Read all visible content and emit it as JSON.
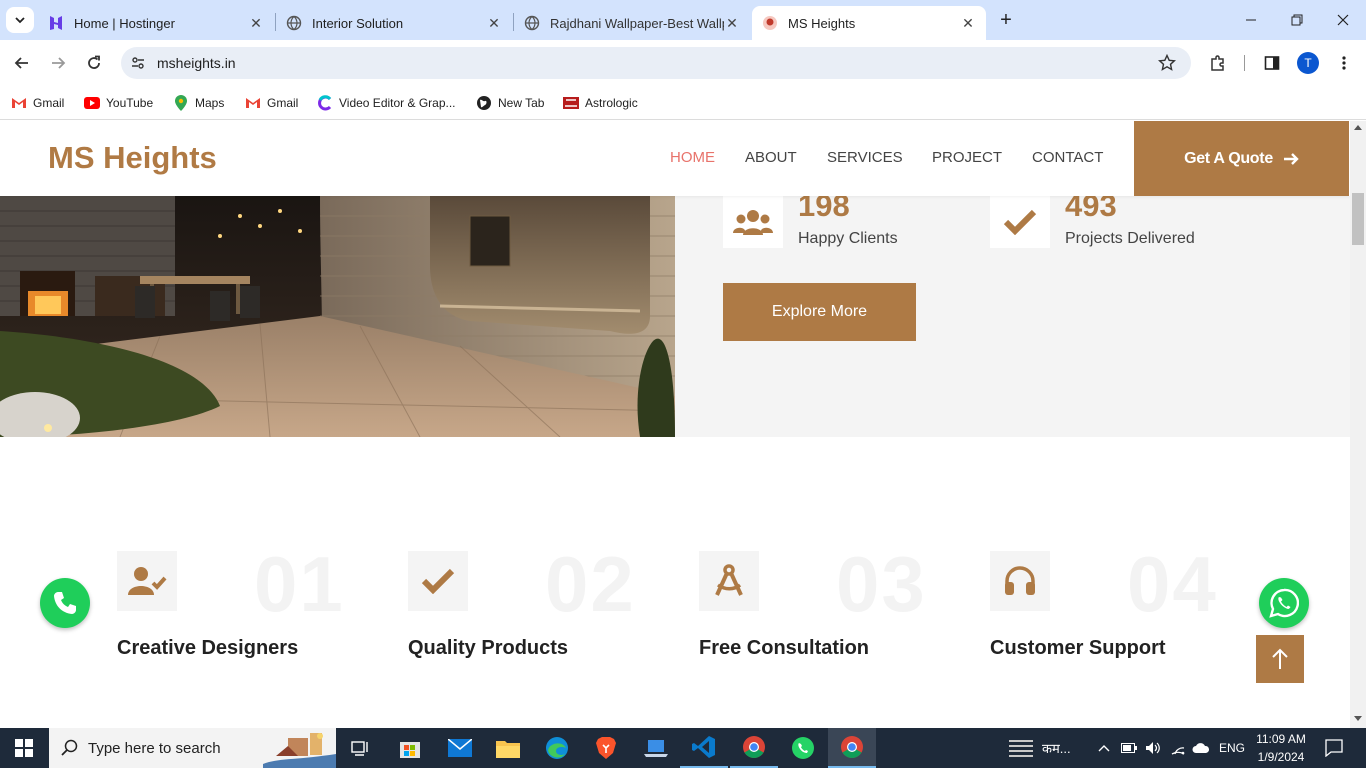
{
  "browser": {
    "tabs": [
      {
        "title": "Home | Hostinger",
        "active": false
      },
      {
        "title": "Interior Solution",
        "active": false
      },
      {
        "title": "Rajdhani Wallpaper-Best Wallpa",
        "active": false
      },
      {
        "title": "MS Heights",
        "active": true
      }
    ],
    "url": "msheights.in",
    "profile_initial": "T",
    "bookmarks": [
      {
        "label": "Gmail",
        "icon": "gmail-icon"
      },
      {
        "label": "YouTube",
        "icon": "youtube-icon"
      },
      {
        "label": "Maps",
        "icon": "maps-icon"
      },
      {
        "label": "Gmail",
        "icon": "gmail-icon"
      },
      {
        "label": "Video Editor & Grap...",
        "icon": "canva-icon"
      },
      {
        "label": "New Tab",
        "icon": "globe-icon"
      },
      {
        "label": "Astrologic",
        "icon": "astrologic-icon"
      }
    ]
  },
  "site": {
    "logo": "MS Heights",
    "nav": [
      "HOME",
      "ABOUT",
      "SERVICES",
      "PROJECT",
      "CONTACT"
    ],
    "quote_button": "Get A Quote",
    "accent_color": "#ae7a45",
    "stats": [
      {
        "number": "198",
        "label": "Happy Clients",
        "icon": "users-icon"
      },
      {
        "number": "493",
        "label": "Projects Delivered",
        "icon": "check-icon"
      }
    ],
    "explore_button": "Explore More",
    "features": [
      {
        "number": "01",
        "title": "Creative Designers",
        "icon": "user-check-icon"
      },
      {
        "number": "02",
        "title": "Quality Products",
        "icon": "check-icon"
      },
      {
        "number": "03",
        "title": "Free Consultation",
        "icon": "drafting-compass-icon"
      },
      {
        "number": "04",
        "title": "Customer Support",
        "icon": "headphones-icon"
      }
    ]
  },
  "taskbar": {
    "search_placeholder": "Type here to search",
    "weather_text": "कम...",
    "language": "ENG",
    "time": "11:09 AM",
    "date": "1/9/2024"
  }
}
